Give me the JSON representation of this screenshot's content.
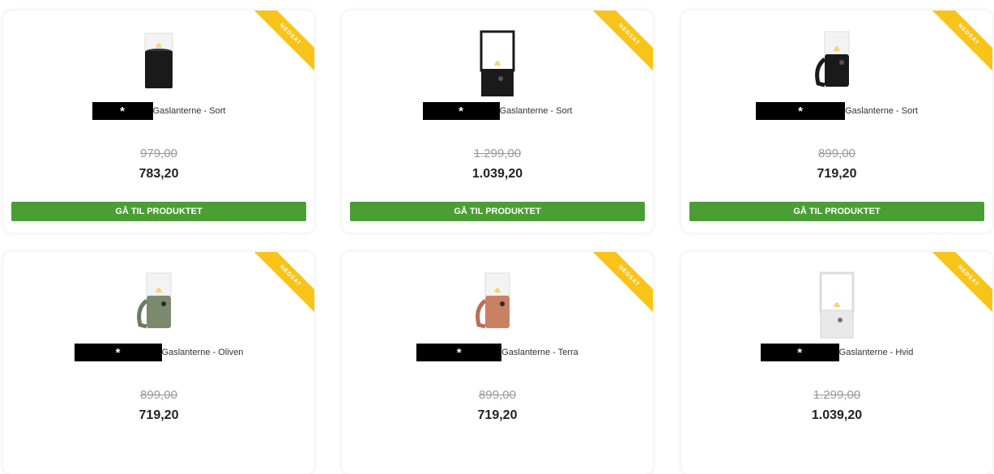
{
  "ribbon_label": "NEDSAT",
  "cta_label": "GÅ TIL PRODUKTET",
  "redaction_mark": "*",
  "colors": {
    "ribbon": "#f9c41a",
    "cta": "#4a9e33",
    "old_price": "#999999",
    "new_price": "#222222"
  },
  "products": [
    {
      "title": "Gaslanterne - Sort",
      "old_price": "979,00",
      "new_price": "783,20",
      "lantern_color": "#1a1a1a",
      "image": "gas-lantern-round-black"
    },
    {
      "title": "Gaslanterne - Sort",
      "old_price": "1.299,00",
      "new_price": "1.039,20",
      "lantern_color": "#1a1a1a",
      "image": "gas-lantern-tall-black"
    },
    {
      "title": "Gaslanterne - Sort",
      "old_price": "899,00",
      "new_price": "719,20",
      "lantern_color": "#1a1a1a",
      "image": "gas-lantern-handle-black"
    },
    {
      "title": "Gaslanterne - Oliven",
      "old_price": "899,00",
      "new_price": "719,20",
      "lantern_color": "#7b8a6e",
      "image": "gas-lantern-handle-olive"
    },
    {
      "title": "Gaslanterne - Terra",
      "old_price": "899,00",
      "new_price": "719,20",
      "lantern_color": "#c98064",
      "image": "gas-lantern-handle-terra"
    },
    {
      "title": "Gaslanterne - Hvid",
      "old_price": "1.299,00",
      "new_price": "1.039,20",
      "lantern_color": "#e9e9e9",
      "image": "gas-lantern-tall-white"
    }
  ]
}
